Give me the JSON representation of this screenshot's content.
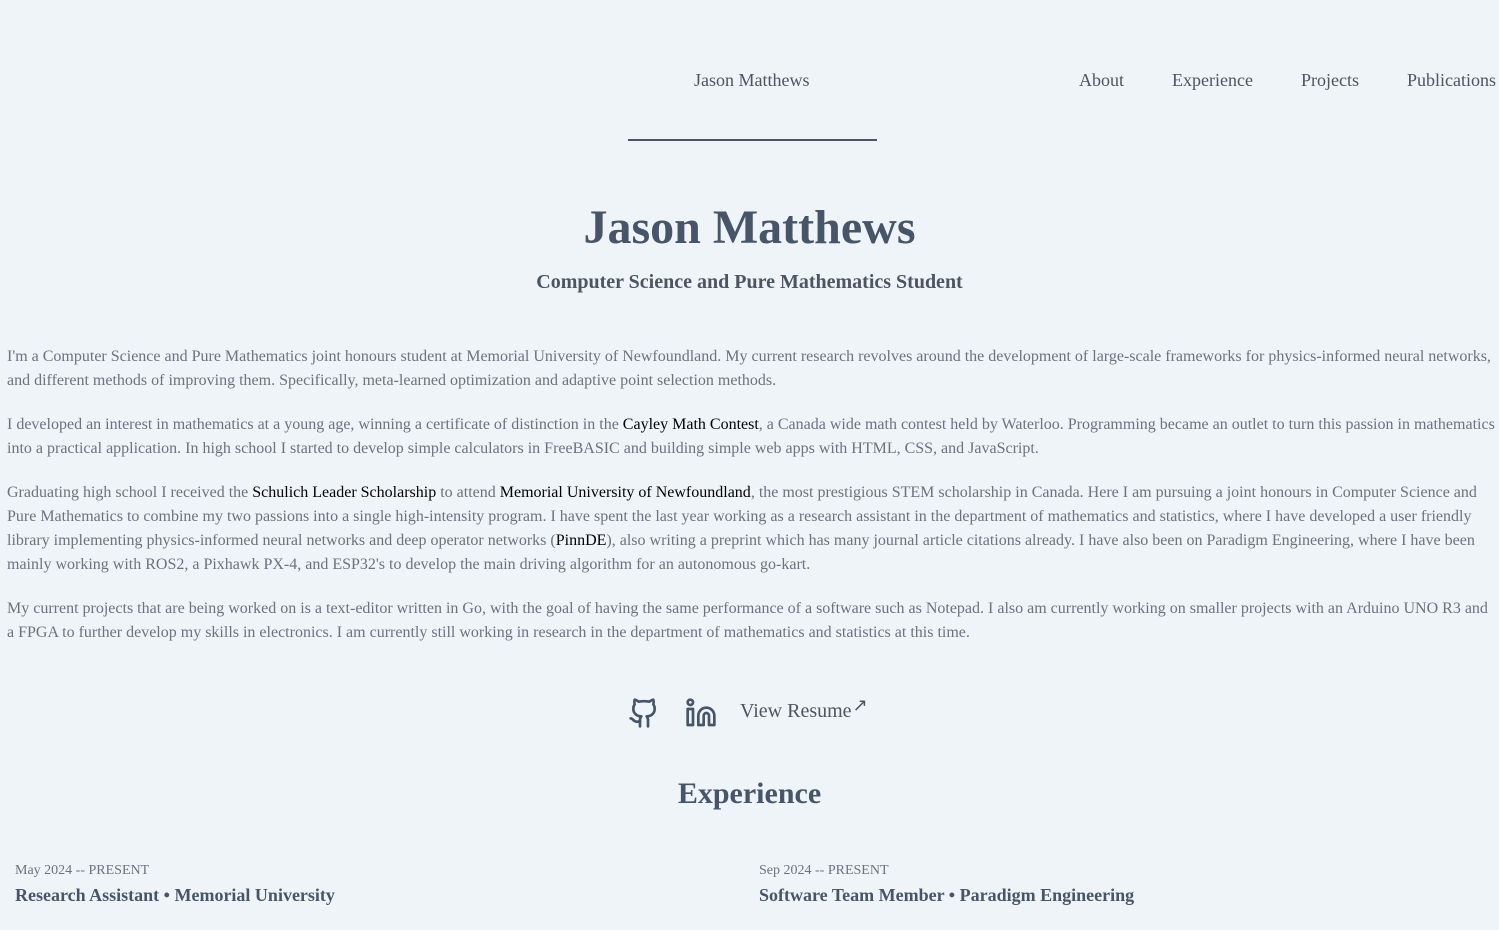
{
  "nav": {
    "brand": "Jason Matthews",
    "links": [
      "About",
      "Experience",
      "Projects",
      "Publications"
    ]
  },
  "hero": {
    "name": "Jason Matthews",
    "subtitle": "Computer Science and Pure Mathematics Student"
  },
  "about": {
    "p1": "I'm a Computer Science and Pure Mathematics joint honours student at Memorial University of Newfoundland. My current research revolves around the development of large-scale frameworks for physics-informed neural networks, and different methods of improving them. Specifically, meta-learned optimization and adaptive point selection methods.",
    "p2_before": "I developed an interest in mathematics at a young age, winning a certificate of distinction in the ",
    "p2_link": "Cayley Math Contest",
    "p2_after": ", a Canada wide math contest held by Waterloo. Programming became an outlet to turn this passion in mathematics into a practical application. In high school I started to develop simple calculators in FreeBASIC and building simple web apps with HTML, CSS, and JavaScript.",
    "p3_before": "Graduating high school I received the ",
    "p3_link1": "Schulich Leader Scholarship",
    "p3_mid1": " to attend ",
    "p3_link2": "Memorial University of Newfoundland",
    "p3_mid2": ", the most prestigious STEM scholarship in Canada. Here I am pursuing a joint honours in Computer Science and Pure Mathematics to combine my two passions into a single high-intensity program. I have spent the last year working as a research assistant in the department of mathematics and statistics, where I have developed a user friendly library implementing physics-informed neural networks and deep operator networks (",
    "p3_link3": "PinnDE",
    "p3_after": "), also writing a preprint which has many journal article citations already. I have also been on Paradigm Engineering, where I have been mainly working with ROS2, a Pixhawk PX-4, and ESP32's to develop the main driving algorithm for an autonomous go-kart.",
    "p4": "My current projects that are being worked on is a text-editor written in Go, with the goal of having the same performance of a software such as Notepad. I also am currently working on smaller projects with an Arduino UNO R3 and a FPGA to further develop my skills in electronics. I am currently still working in research in the department of mathematics and statistics at this time."
  },
  "socials": {
    "github_icon": "github-icon",
    "linkedin_icon": "linkedin-icon",
    "resume_label": "View Resume",
    "resume_arrow": "↗"
  },
  "experience": {
    "title": "Experience",
    "items": [
      {
        "date": "May 2024 -- PRESENT",
        "role": "Research Assistant • Memorial University"
      },
      {
        "date": "Sep 2024 -- PRESENT",
        "role": "Software Team Member • Paradigm Engineering"
      }
    ]
  },
  "colors": {
    "background": "#eff4f8",
    "heading": "#475569",
    "body_text": "#6b7280",
    "link": "#000000"
  }
}
